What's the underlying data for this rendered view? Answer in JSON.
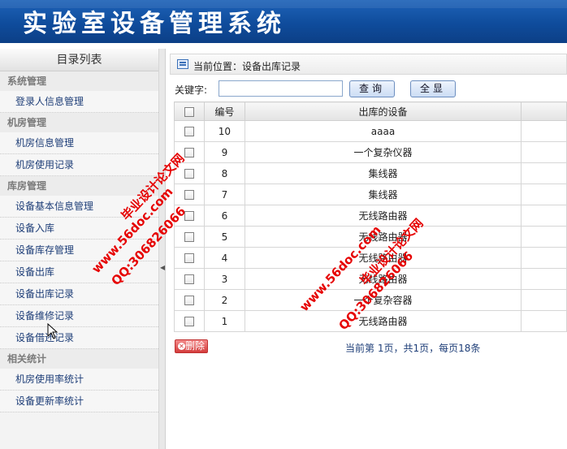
{
  "header": {
    "title": "实验室设备管理系统"
  },
  "sidebar": {
    "title": "目录列表",
    "groups": [
      {
        "label": "系统管理",
        "items": [
          "登录人信息管理"
        ]
      },
      {
        "label": "机房管理",
        "items": [
          "机房信息管理",
          "机房使用记录"
        ]
      },
      {
        "label": "库房管理",
        "items": [
          "设备基本信息管理",
          "设备入库",
          "设备库存管理",
          "设备出库",
          "设备出库记录",
          "设备维修记录",
          "设备借还记录"
        ]
      },
      {
        "label": "相关统计",
        "items": [
          "机房使用率统计",
          "设备更新率统计"
        ]
      }
    ]
  },
  "breadcrumb": {
    "text": "当前位置：设备出库记录"
  },
  "search": {
    "label": "关键字:",
    "value": "",
    "query_button": "查询",
    "show_all_button": "全显"
  },
  "table": {
    "headers": [
      "",
      "编号",
      "出库的设备",
      ""
    ],
    "rows": [
      {
        "id": "10",
        "device": "aaaa"
      },
      {
        "id": "9",
        "device": "一个复杂仪器"
      },
      {
        "id": "8",
        "device": "集线器"
      },
      {
        "id": "7",
        "device": "集线器"
      },
      {
        "id": "6",
        "device": "无线路由器"
      },
      {
        "id": "5",
        "device": "无线路由器"
      },
      {
        "id": "4",
        "device": "无线路由器"
      },
      {
        "id": "3",
        "device": "无线路由器"
      },
      {
        "id": "2",
        "device": "一个复杂容器"
      },
      {
        "id": "1",
        "device": "无线路由器"
      }
    ]
  },
  "actions": {
    "delete_button": "删除"
  },
  "pager": {
    "text": "当前第 1页，共1页，每页18条"
  },
  "watermarks": {
    "left": {
      "line1": "毕业设计论文网",
      "line2": "QQ:306826066",
      "line3": "www.56doc.com"
    },
    "right": {
      "line1": "www.56doc.com",
      "line2": "QQ:306826066",
      "line3": "毕业设计论文网"
    }
  },
  "colors": {
    "header_bg": "#0f4c9c",
    "link": "#1e3e78",
    "watermark": "#e60000",
    "delete": "#d43c3c"
  }
}
